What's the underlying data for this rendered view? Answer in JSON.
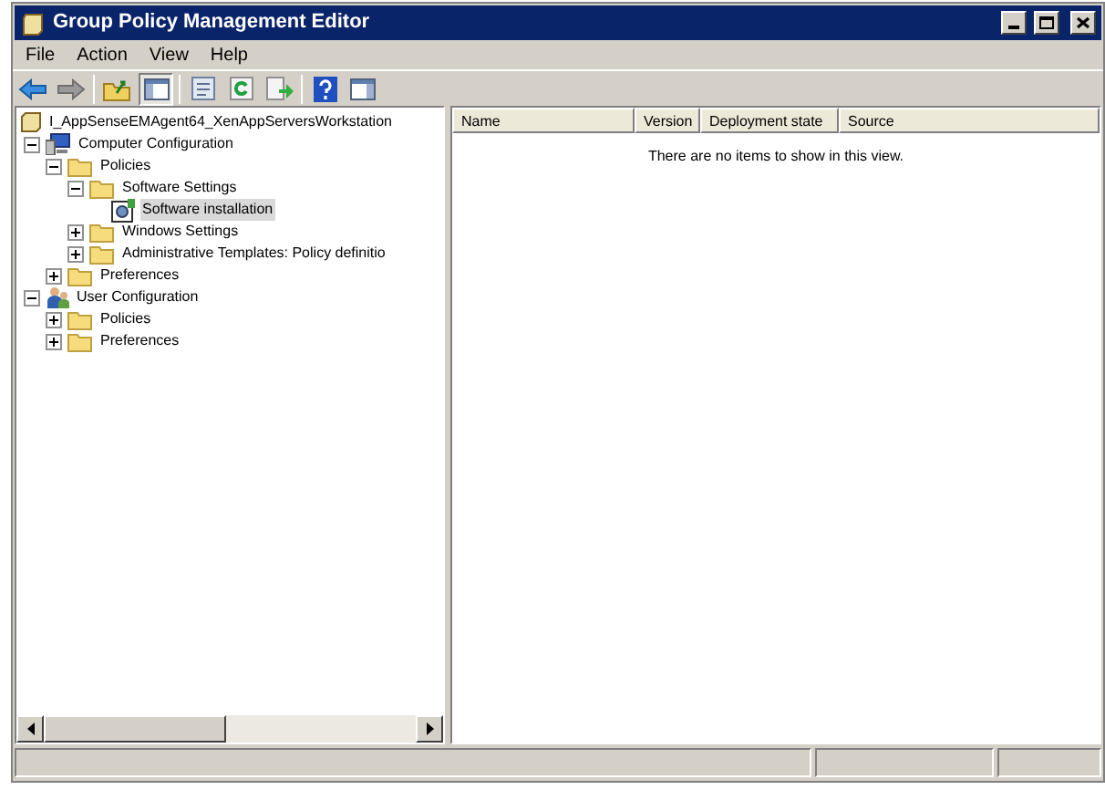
{
  "window": {
    "title": "Group Policy Management Editor"
  },
  "menu": [
    "File",
    "Action",
    "View",
    "Help"
  ],
  "tree": [
    {
      "label": "I_AppSenseEMAgent64_XenAppServersWorkstation",
      "kind": "gpo",
      "selected": false,
      "children": [
        {
          "label": "Computer Configuration",
          "kind": "computer",
          "expanded": true,
          "selected": false,
          "children": [
            {
              "label": "Policies",
              "kind": "folder",
              "expanded": true,
              "selected": false,
              "children": [
                {
                  "label": "Software Settings",
                  "kind": "folder",
                  "expanded": true,
                  "selected": false,
                  "children": [
                    {
                      "label": "Software installation",
                      "kind": "software",
                      "selected": true
                    }
                  ]
                },
                {
                  "label": "Windows Settings",
                  "kind": "folder",
                  "expanded": false,
                  "selected": false
                },
                {
                  "label": "Administrative Templates: Policy definitio",
                  "kind": "folder",
                  "expanded": false,
                  "selected": false
                }
              ]
            },
            {
              "label": "Preferences",
              "kind": "folder",
              "expanded": false,
              "selected": false
            }
          ]
        },
        {
          "label": "User Configuration",
          "kind": "user",
          "expanded": true,
          "selected": false,
          "children": [
            {
              "label": "Policies",
              "kind": "folder",
              "expanded": false,
              "selected": false
            },
            {
              "label": "Preferences",
              "kind": "folder",
              "expanded": false,
              "selected": false
            }
          ]
        }
      ]
    }
  ],
  "list": {
    "columns": [
      "Name",
      "Version",
      "Deployment state",
      "Source"
    ],
    "empty_message": "There are no items to show in this view."
  }
}
